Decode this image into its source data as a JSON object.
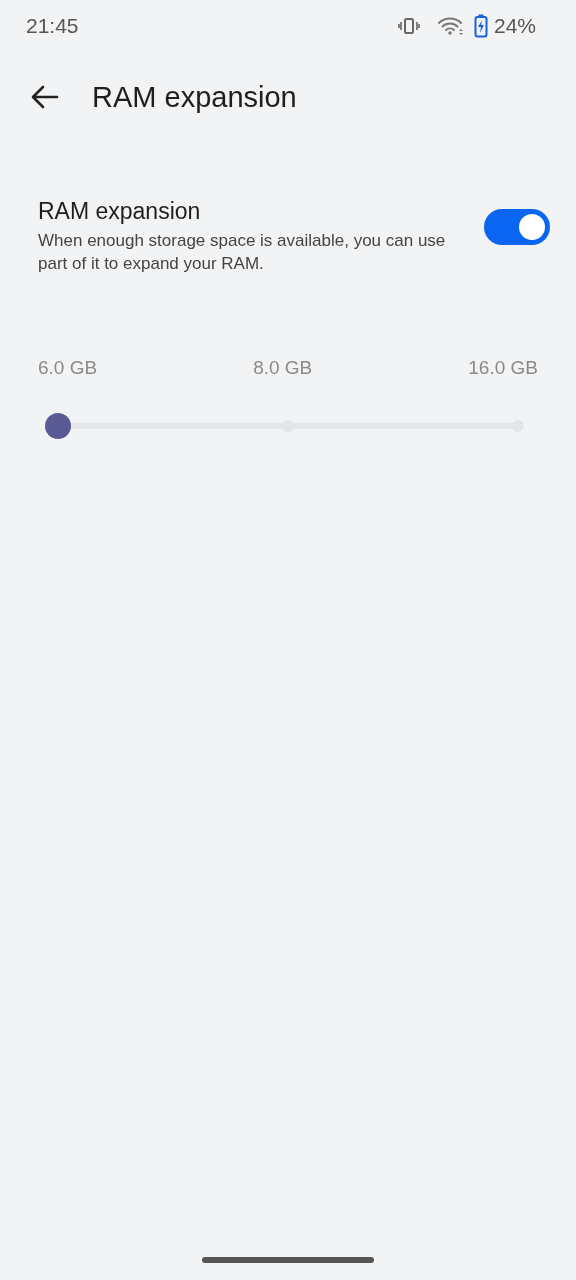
{
  "status_bar": {
    "time": "21:45",
    "battery": "24%"
  },
  "header": {
    "title": "RAM expansion"
  },
  "setting": {
    "title": "RAM expansion",
    "description": "When enough storage space is available, you can use part of it to expand your RAM.",
    "on": true
  },
  "slider": {
    "labels": [
      "6.0 GB",
      "8.0 GB",
      "16.0 GB"
    ],
    "level": 0
  }
}
